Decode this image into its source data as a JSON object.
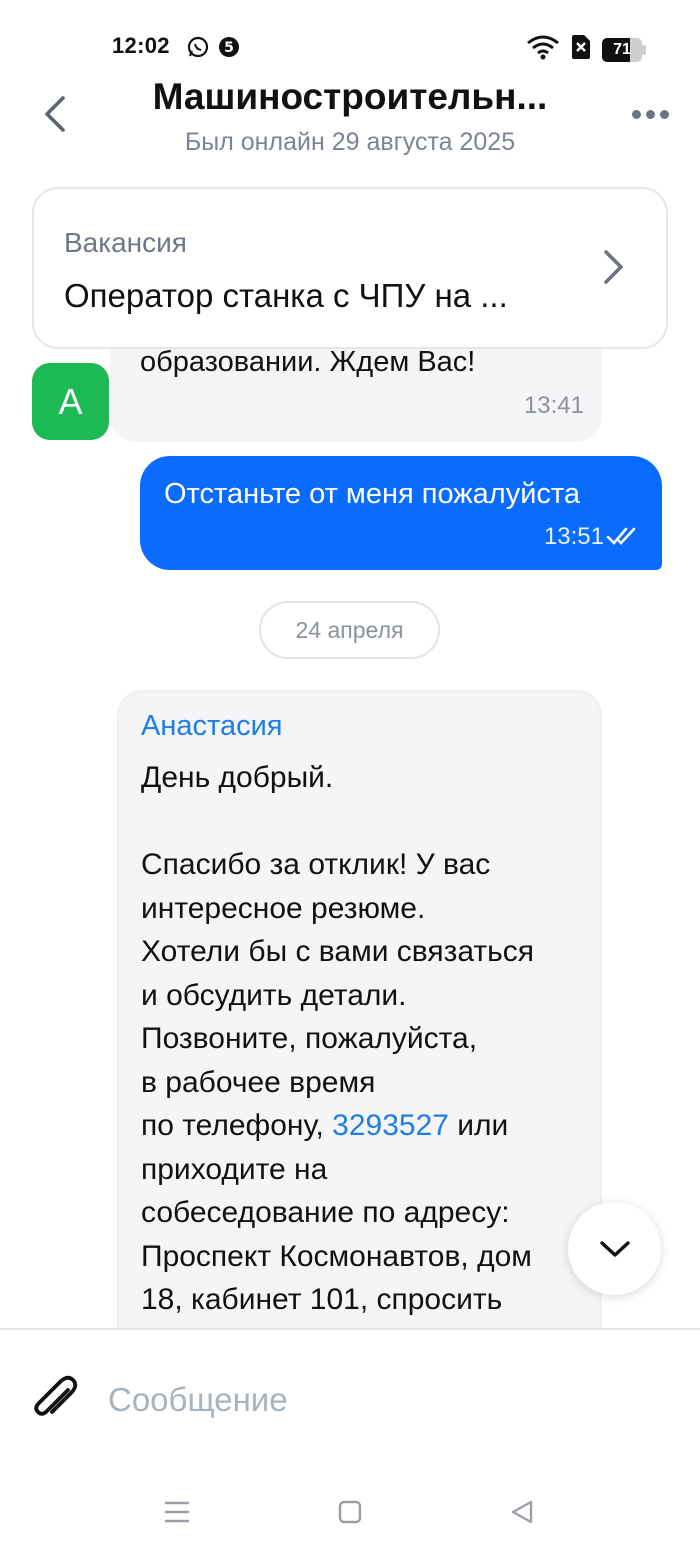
{
  "status_bar": {
    "time": "12:02",
    "app_icons": [
      "whatsapp-icon",
      "five-badge-icon"
    ],
    "right_icons": [
      "wifi-icon",
      "sim-off-icon",
      "battery-icon"
    ],
    "battery_level": "71",
    "battery_fraction": 0.71
  },
  "header": {
    "title": "Машиностроительн...",
    "subtitle": "Был онлайн 29 августа 2025",
    "back_icon": "chevron-left-icon",
    "more_icon": "more-dots-icon"
  },
  "vacancy": {
    "label": "Вакансия",
    "title": "Оператор станка с ЧПУ на ...",
    "icon": "chevron-right-icon"
  },
  "messages": {
    "incoming_top": {
      "avatar_letter": "А",
      "text": "образовании. Ждем Вас!",
      "time": "13:41"
    },
    "outgoing": {
      "text": "Отстаньте от меня пожалуйста",
      "time": "13:51",
      "status_icon": "double-check-icon"
    },
    "date_separator": "24 апреля",
    "incoming_main": {
      "sender": "Анастасия",
      "text_before_phone": "День добрый.\n\nСпасибо за отклик! У вас\nинтересное резюме.\nХотели бы с вами связаться\nи обсудить детали.\nПозвоните, пожалуйста,\nв рабочее время\nпо телефону, ",
      "phone": "3293527",
      "text_after_phone": " или\nприходите на\nсобеседование по адресу:\nПроспект Космонавтов, дом\n18, кабинет 101, спросить"
    }
  },
  "scroll_down_icon": "chevron-down-icon",
  "composer": {
    "attach_icon": "paperclip-icon",
    "placeholder": "Сообщение",
    "value": ""
  },
  "nav_bar": {
    "buttons": [
      "menu-icon",
      "home-square-icon",
      "back-triangle-icon"
    ]
  },
  "colors": {
    "accent_blue": "#0a6cff",
    "link_blue": "#1f7de6",
    "avatar_green": "#1db954",
    "bubble_gray": "#f5f5f7",
    "muted_text": "#7b8592"
  }
}
